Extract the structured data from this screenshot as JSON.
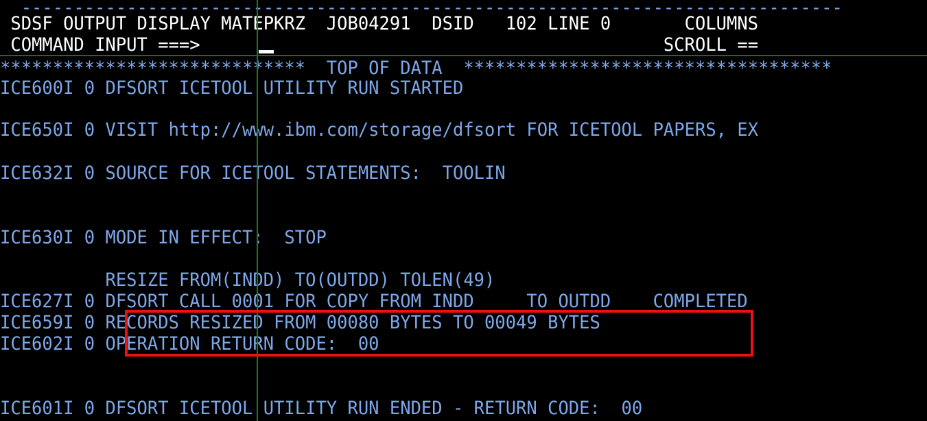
{
  "terminal": {
    "colors": {
      "background": "#000000",
      "header_text": "#ffffff",
      "body_text": "#7da7e8",
      "guide_line": "#1d7a1d",
      "highlight_border": "#ee1111",
      "cursor": "#ffffff"
    }
  },
  "header": {
    "top_rule": "  ------------------------------------------------------------------------------",
    "title_line": " SDSF OUTPUT DISPLAY MATEPKRZ  JOB04291  DSID   102 LINE 0       COLUMNS",
    "command_line": " COMMAND INPUT ===>                                            SCROLL ==",
    "fields": {
      "app_name": "SDSF",
      "panel": "OUTPUT DISPLAY",
      "job_name": "MATEPKRZ",
      "job_id": "JOB04291",
      "dsid_label": "DSID",
      "dsid_value": "102",
      "line_label": "LINE",
      "line_value": "0",
      "columns_label": "COLUMNS",
      "command_label": "COMMAND INPUT ===>",
      "command_value": "",
      "scroll_label": "SCROLL ==",
      "cursor_glyph": "_"
    }
  },
  "body": {
    "lines": [
      "*****************************  TOP OF DATA  ***********************************",
      "ICE600I 0 DFSORT ICETOOL UTILITY RUN STARTED",
      "",
      "ICE650I 0 VISIT http://www.ibm.com/storage/dfsort FOR ICETOOL PAPERS, EX",
      "",
      "ICE632I 0 SOURCE FOR ICETOOL STATEMENTS:  TOOLIN",
      "",
      "",
      "ICE630I 0 MODE IN EFFECT:  STOP",
      "",
      "          RESIZE FROM(INDD) TO(OUTDD) TOLEN(49)",
      "ICE627I 0 DFSORT CALL 0001 FOR COPY FROM INDD     TO OUTDD    COMPLETED",
      "ICE659I 0 RECORDS RESIZED FROM 00080 BYTES TO 00049 BYTES",
      "ICE602I 0 OPERATION RETURN CODE:  00",
      "",
      "",
      "ICE601I 0 DFSORT ICETOOL UTILITY RUN ENDED - RETURN CODE:  00"
    ]
  },
  "highlight": {
    "label": "records-resized-and-return-code-highlight",
    "lines": [
      "RECORDS RESIZED FROM 00080 BYTES TO 00049 BYTES",
      "OPERATION RETURN CODE:  00"
    ],
    "values": {
      "from_bytes": "00080",
      "to_bytes": "00049",
      "return_code": "00"
    }
  }
}
